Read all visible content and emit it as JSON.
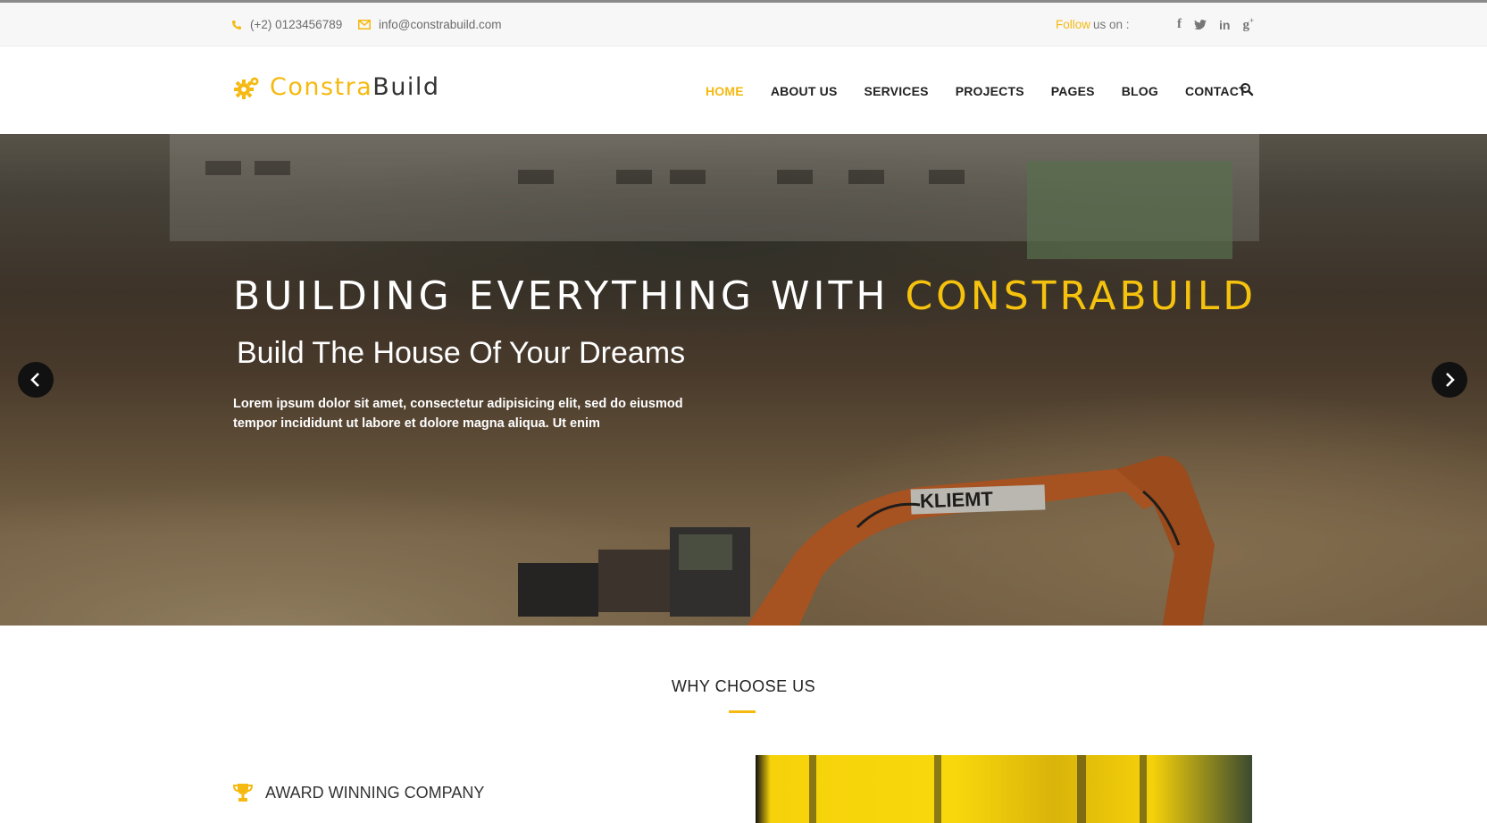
{
  "topbar": {
    "phone": "(+2) 0123456789",
    "email": "info@constrabuild.com",
    "follow_accent": "Follow",
    "follow_rest": "us on :",
    "social_icons": [
      "facebook-icon",
      "twitter-icon",
      "linkedin-icon",
      "google-plus-icon"
    ]
  },
  "header": {
    "logo_part1": "Constra",
    "logo_part2": "Build",
    "nav": [
      "HOME",
      "ABOUT US",
      "SERVICES",
      "PROJECTS",
      "PAGES",
      "BLOG",
      "CONTACT"
    ],
    "active_nav": "HOME"
  },
  "hero": {
    "title_white": "BUILDING EVERYTHING WITH ",
    "title_accent": "CONSTRABUILD",
    "subtitle": "Build The House Of Your Dreams",
    "text": "Lorem ipsum dolor sit amet, consectetur adipisicing elit, sed do eiusmod tempor incididunt ut labore et dolore magna aliqua. Ut enim",
    "machine_label": "KLIEMT"
  },
  "why": {
    "title": "WHY CHOOSE US",
    "feature": "AWARD WINNING COMPANY"
  },
  "colors": {
    "accent": "#f5b90f",
    "text_dark": "#222222"
  }
}
